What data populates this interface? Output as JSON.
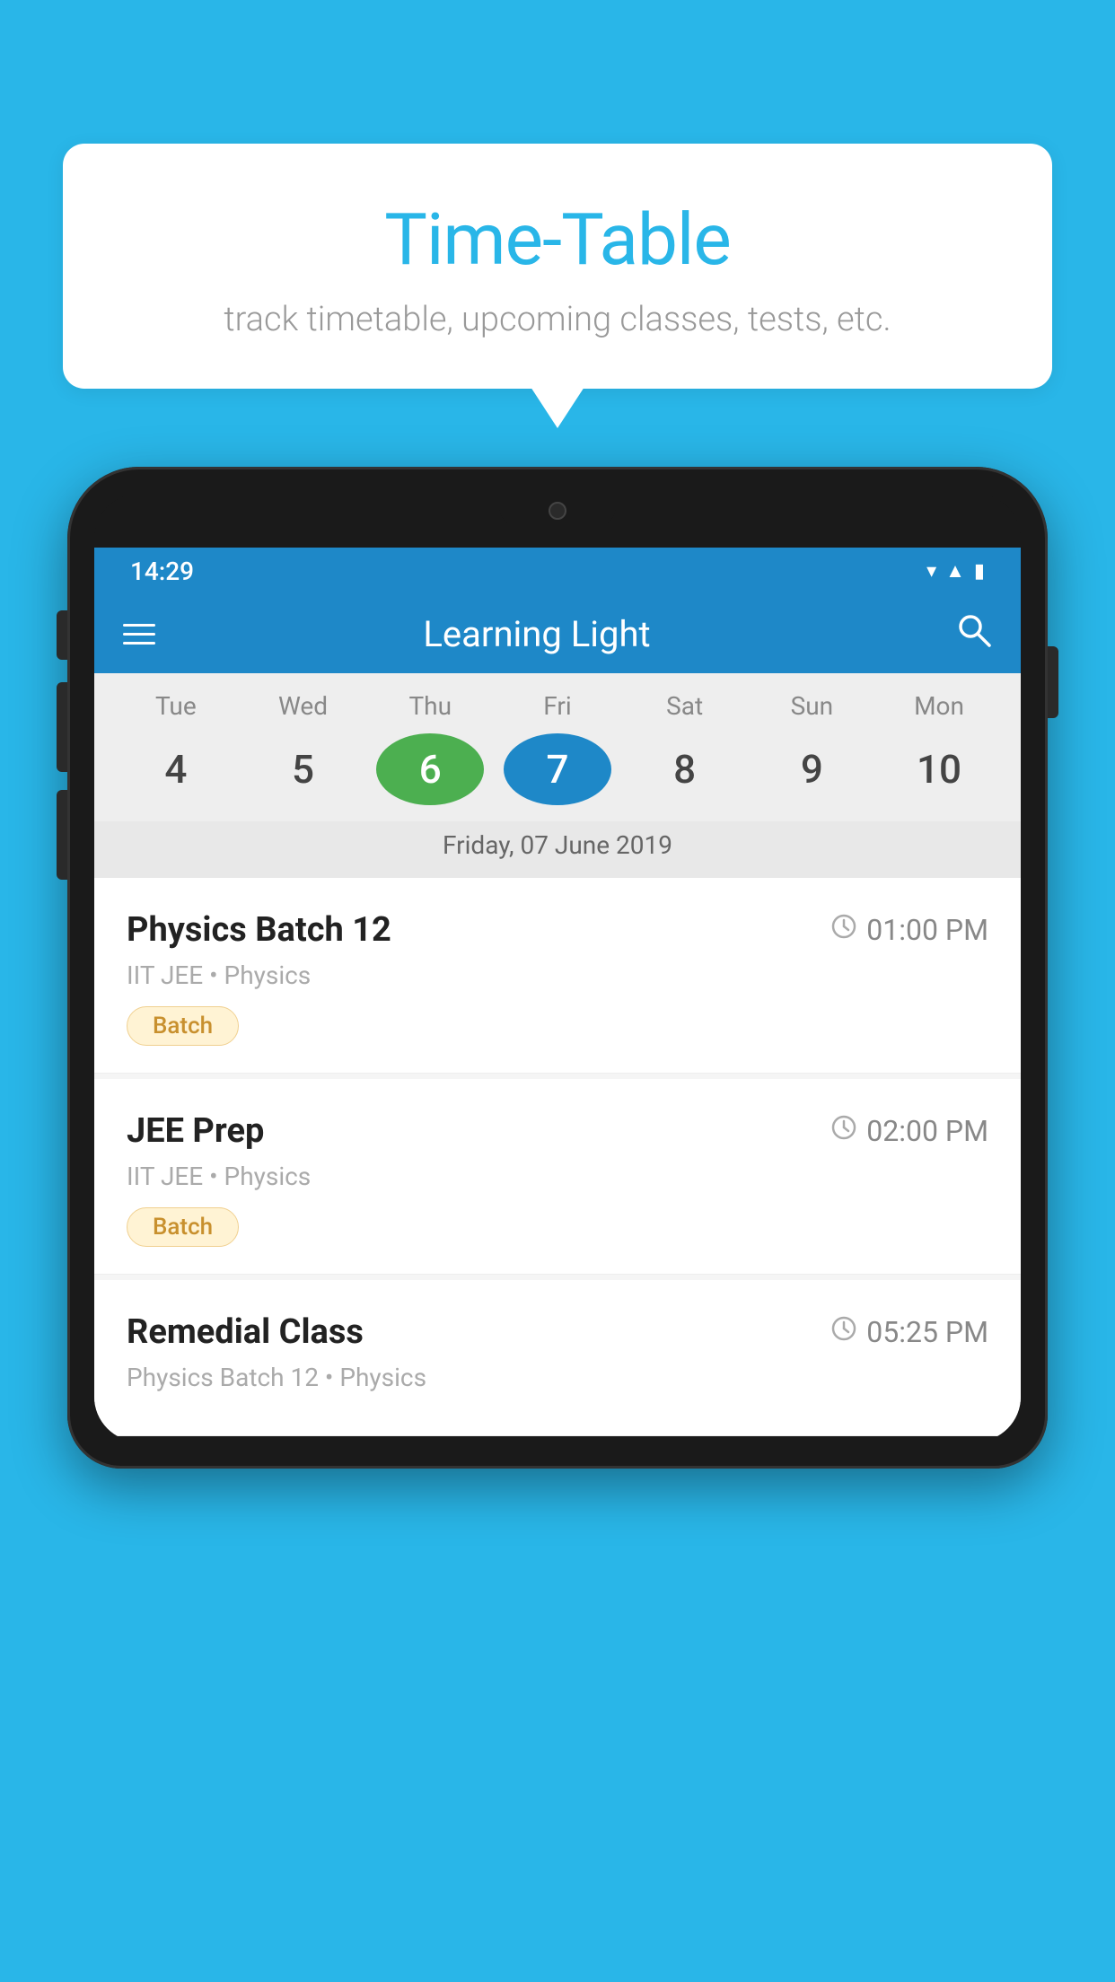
{
  "background_color": "#29b6e8",
  "tooltip": {
    "title": "Time-Table",
    "subtitle": "track timetable, upcoming classes, tests, etc."
  },
  "status_bar": {
    "time": "14:29",
    "wifi_icon": "▾",
    "signal_icon": "▲",
    "battery_icon": "▮"
  },
  "toolbar": {
    "app_name": "Learning Light",
    "hamburger_label": "menu",
    "search_label": "search"
  },
  "calendar": {
    "date_label": "Friday, 07 June 2019",
    "days": [
      {
        "short": "Tue",
        "num": "4",
        "state": "normal"
      },
      {
        "short": "Wed",
        "num": "5",
        "state": "normal"
      },
      {
        "short": "Thu",
        "num": "6",
        "state": "today"
      },
      {
        "short": "Fri",
        "num": "7",
        "state": "selected"
      },
      {
        "short": "Sat",
        "num": "8",
        "state": "normal"
      },
      {
        "short": "Sun",
        "num": "9",
        "state": "normal"
      },
      {
        "short": "Mon",
        "num": "10",
        "state": "normal"
      }
    ]
  },
  "schedule": [
    {
      "title": "Physics Batch 12",
      "time": "01:00 PM",
      "subtitle": "IIT JEE • Physics",
      "tag": "Batch"
    },
    {
      "title": "JEE Prep",
      "time": "02:00 PM",
      "subtitle": "IIT JEE • Physics",
      "tag": "Batch"
    },
    {
      "title": "Remedial Class",
      "time": "05:25 PM",
      "subtitle": "Physics Batch 12 • Physics",
      "tag": ""
    }
  ]
}
